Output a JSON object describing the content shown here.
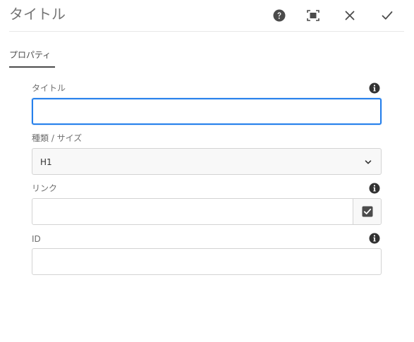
{
  "dialog": {
    "title": "タイトル",
    "header_icons": {
      "help": "help-icon",
      "fullscreen": "fullscreen-icon",
      "close": "close-icon",
      "confirm": "checkmark-icon"
    }
  },
  "tabs": [
    {
      "label": "プロパティ",
      "selected": true
    }
  ],
  "form": {
    "title_field": {
      "label": "タイトル",
      "value": "",
      "placeholder": ""
    },
    "type_size_field": {
      "label": "種類 / サイズ",
      "selected": "H1"
    },
    "link_field": {
      "label": "リンク",
      "value": "",
      "placeholder": ""
    },
    "id_field": {
      "label": "ID",
      "value": "",
      "placeholder": ""
    }
  },
  "colors": {
    "focus_border": "#2680eb",
    "icon_dark": "#4b4b4b",
    "label_text": "#6e6e6e"
  }
}
